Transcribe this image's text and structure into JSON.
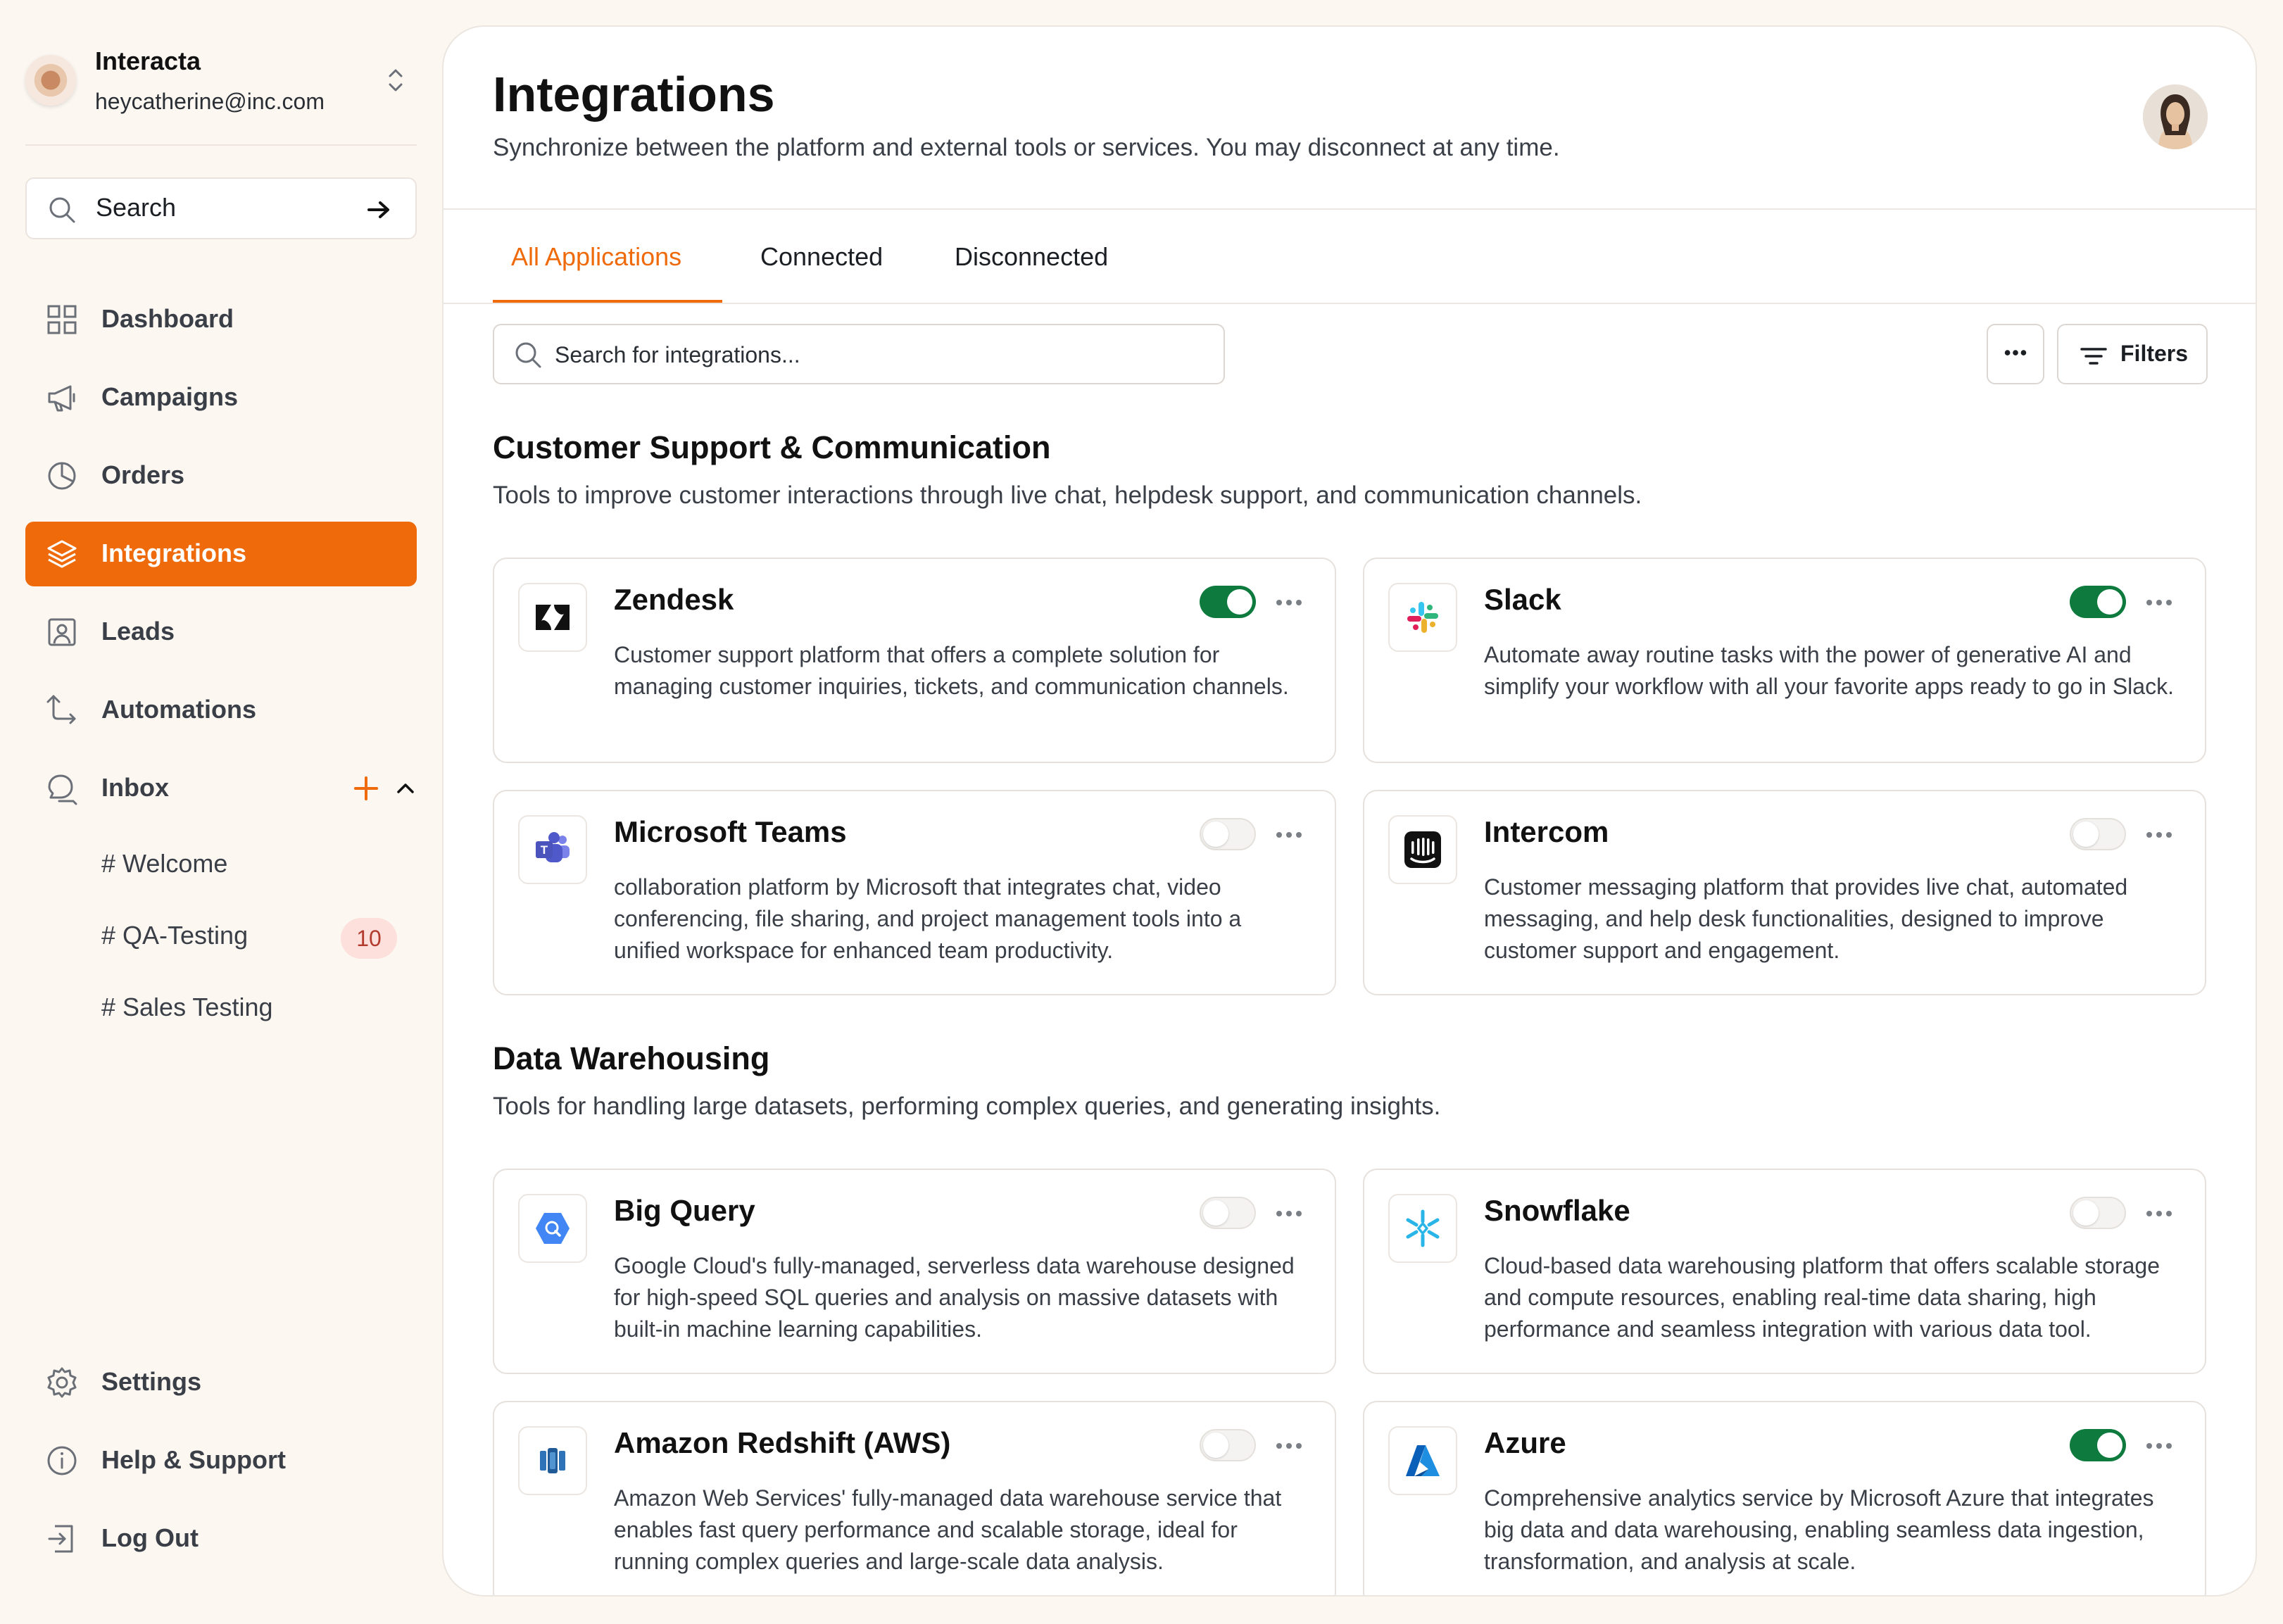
{
  "account": {
    "name": "Interacta",
    "email": "heycatherine@inc.com"
  },
  "sidebar": {
    "search_label": "Search",
    "items": [
      {
        "label": "Dashboard",
        "icon": "dashboard-icon"
      },
      {
        "label": "Campaigns",
        "icon": "megaphone-icon"
      },
      {
        "label": "Orders",
        "icon": "pie-chart-icon"
      },
      {
        "label": "Integrations",
        "icon": "layers-icon",
        "active": true
      },
      {
        "label": "Leads",
        "icon": "contact-icon"
      },
      {
        "label": "Automations",
        "icon": "route-icon"
      },
      {
        "label": "Inbox",
        "icon": "chat-icon"
      }
    ],
    "channels": [
      {
        "label": "# Welcome"
      },
      {
        "label": "# QA-Testing",
        "badge": "10"
      },
      {
        "label": "# Sales Testing"
      }
    ],
    "footer": [
      {
        "label": "Settings",
        "icon": "gear-icon"
      },
      {
        "label": "Help & Support",
        "icon": "info-icon"
      },
      {
        "label": "Log Out",
        "icon": "logout-icon"
      }
    ]
  },
  "page": {
    "title": "Integrations",
    "subtitle": "Synchronize between the platform and external tools or services. You may disconnect at any time."
  },
  "tabs": [
    {
      "label": "All Applications",
      "active": true
    },
    {
      "label": "Connected"
    },
    {
      "label": "Disconnected"
    }
  ],
  "search": {
    "placeholder": "Search for integrations..."
  },
  "filters_label": "Filters",
  "sections": [
    {
      "title": "Customer Support & Communication",
      "subtitle": "Tools to improve customer interactions through live chat, helpdesk support, and communication channels.",
      "cards": [
        {
          "name": "Zendesk",
          "enabled": true,
          "desc": "Customer support platform that offers a complete solution for managing customer inquiries, tickets, and communication channels."
        },
        {
          "name": "Slack",
          "enabled": true,
          "desc": "Automate away routine tasks with the power of generative AI and simplify your workflow with all your favorite apps ready to go in Slack."
        },
        {
          "name": "Microsoft Teams",
          "enabled": false,
          "desc": "collaboration platform by Microsoft that integrates chat, video conferencing, file sharing, and project management tools into a unified workspace for enhanced team productivity."
        },
        {
          "name": "Intercom",
          "enabled": false,
          "desc": "Customer messaging platform that provides live chat, automated messaging, and help desk functionalities, designed to improve customer support and engagement."
        }
      ]
    },
    {
      "title": "Data Warehousing",
      "subtitle": "Tools for handling large datasets, performing complex queries, and generating insights.",
      "cards": [
        {
          "name": "Big Query",
          "enabled": false,
          "desc": "Google Cloud's fully-managed, serverless data warehouse designed for high-speed SQL queries and analysis on massive datasets with built-in machine learning capabilities."
        },
        {
          "name": "Snowflake",
          "enabled": false,
          "desc": "Cloud-based data warehousing platform that offers scalable storage and compute resources, enabling real-time data sharing, high performance and seamless integration with various data tool."
        },
        {
          "name": "Amazon Redshift (AWS)",
          "enabled": false,
          "desc": "Amazon Web Services' fully-managed data warehouse service that enables fast query performance and scalable storage, ideal for running complex queries and large-scale data analysis."
        },
        {
          "name": "Azure",
          "enabled": true,
          "desc": "Comprehensive analytics service by Microsoft Azure that integrates big data and data warehousing, enabling seamless data ingestion, transformation, and analysis at scale."
        }
      ]
    }
  ],
  "colors": {
    "accent": "#ee6a0a",
    "toggle_on": "#0e7a3d",
    "badge_bg": "#fde0dc",
    "badge_text": "#b23b2e"
  }
}
